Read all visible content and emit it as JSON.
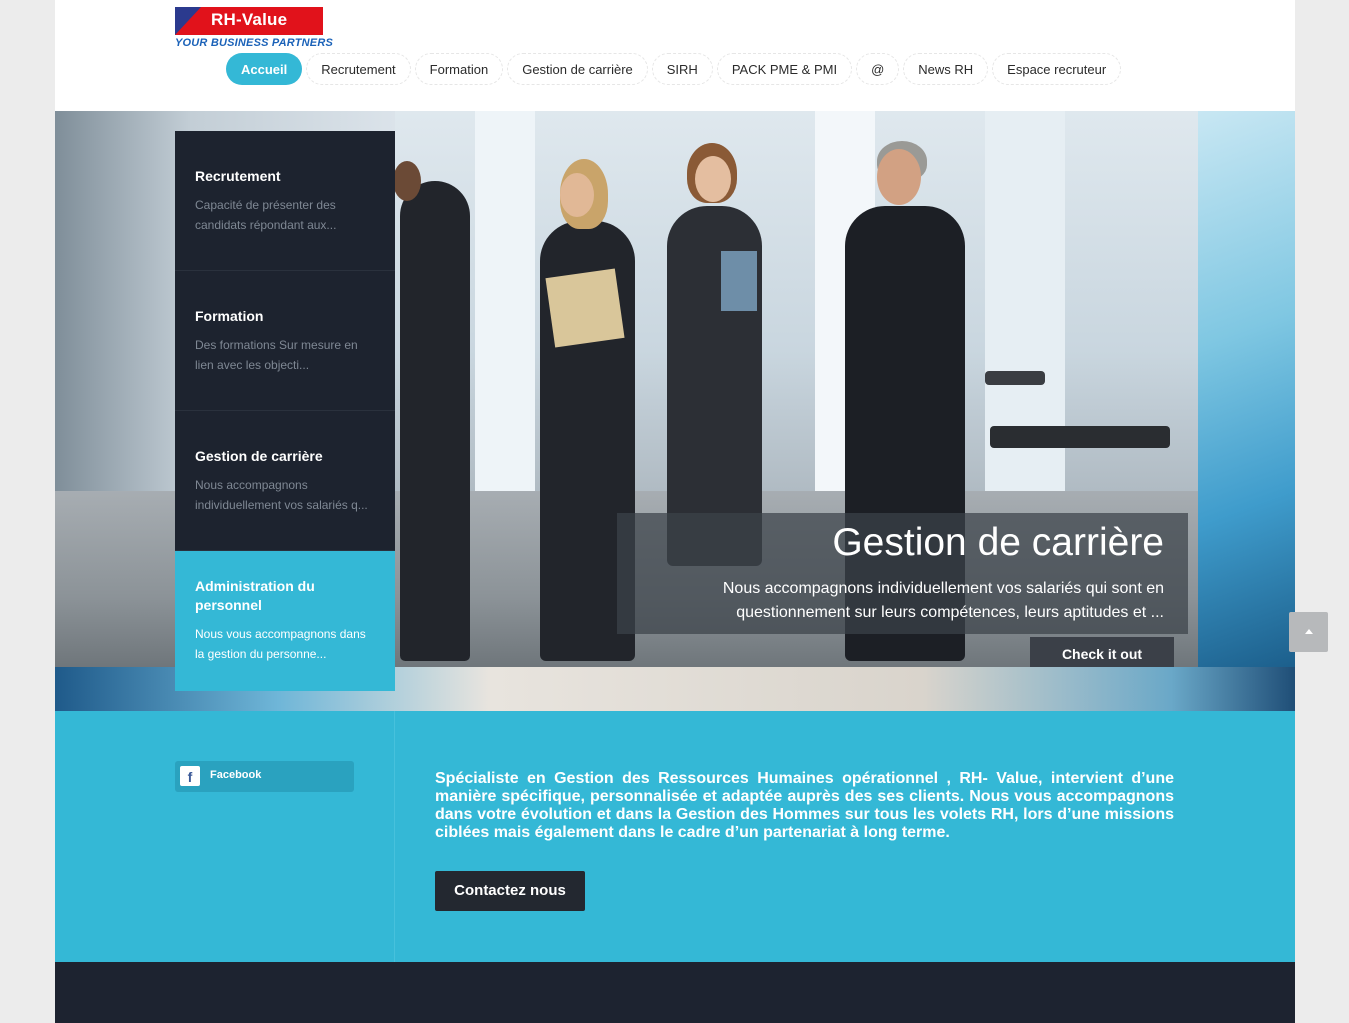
{
  "brand": {
    "name": "RH-Value",
    "tagline": "YOUR BUSINESS PARTNERS"
  },
  "nav": {
    "items": [
      {
        "label": "Accueil",
        "active": true
      },
      {
        "label": "Recrutement",
        "active": false
      },
      {
        "label": "Formation",
        "active": false
      },
      {
        "label": "Gestion de carrière",
        "active": false
      },
      {
        "label": "SIRH",
        "active": false
      },
      {
        "label": "PACK PME & PMI",
        "active": false
      },
      {
        "label": "@",
        "active": false
      },
      {
        "label": "News RH",
        "active": false
      },
      {
        "label": "Espace recruteur",
        "active": false
      }
    ]
  },
  "slider": {
    "menu": [
      {
        "title": "Recrutement",
        "desc": "Capacité de présenter  des candidats répondant aux..."
      },
      {
        "title": "Formation",
        "desc": "Des formations Sur mesure en lien avec les objecti..."
      },
      {
        "title": "Gestion de carrière",
        "desc": "Nous  accompagnons individuellement vos salariés q..."
      },
      {
        "title": "Administration du personnel",
        "desc": "Nous vous accompagnons dans la gestion du personne...",
        "active": true
      }
    ],
    "caption": {
      "title": "Gestion de carrière",
      "text": "Nous  accompagnons individuellement vos salariés qui sont en questionnement sur leurs compétences, leurs aptitudes et ...",
      "button": "Check it out"
    }
  },
  "social": {
    "facebook_label": "Facebook",
    "facebook_icon": "f"
  },
  "intro": {
    "text": "Spécialiste en Gestion des Ressources Humaines opérationnel , RH- Value, intervient d’une manière spécifique, personnalisée et adaptée auprès des ses clients. Nous vous accompagnons dans votre évolution et dans la Gestion des Hommes sur tous les volets RH, lors d’une missions ciblées mais également dans le cadre d’un partenariat à long terme.",
    "button": "Contactez nous"
  },
  "colors": {
    "accent": "#34b8d6",
    "dark": "#1d232f",
    "brand_red": "#e1121b",
    "brand_blue": "#2b3a8e"
  }
}
